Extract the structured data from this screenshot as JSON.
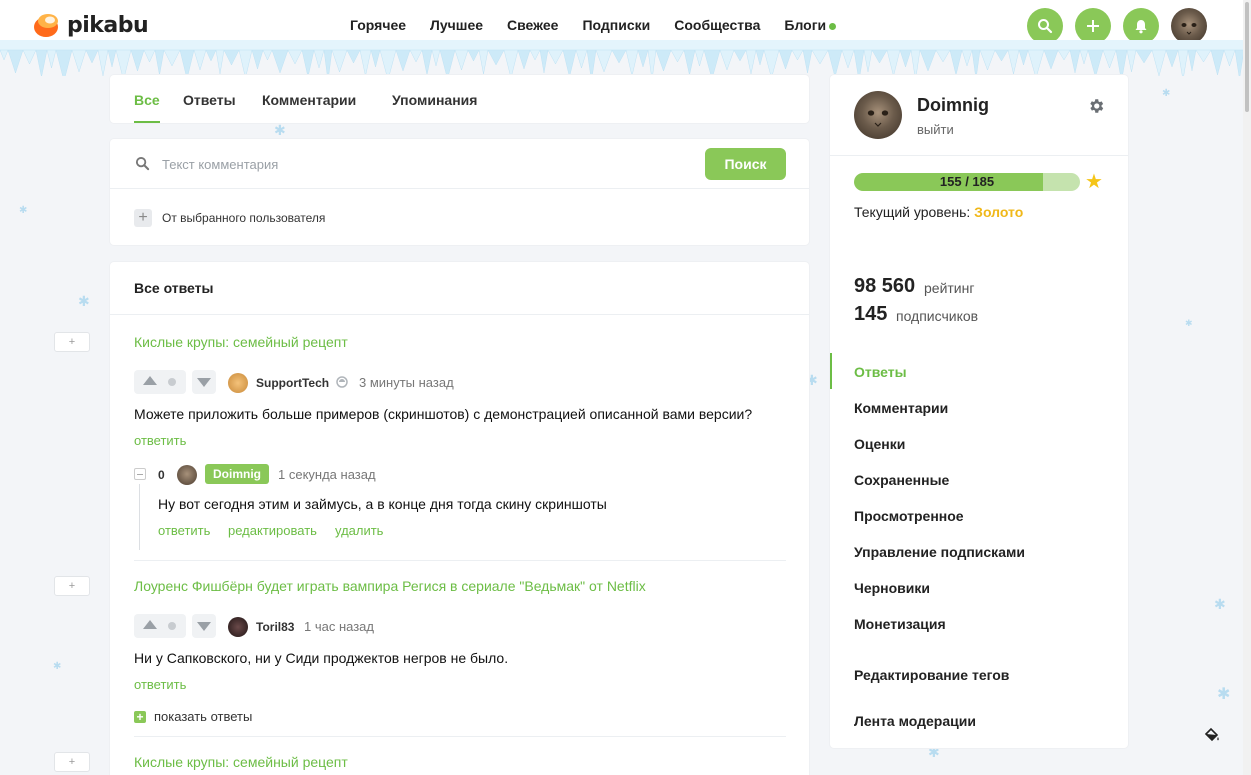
{
  "brand": {
    "name": "pikabu"
  },
  "nav": [
    {
      "label": "Горячее"
    },
    {
      "label": "Лучшее"
    },
    {
      "label": "Свежее"
    },
    {
      "label": "Подписки"
    },
    {
      "label": "Сообщества"
    },
    {
      "label": "Блоги"
    }
  ],
  "header_icons": [
    "search-icon",
    "plus-icon",
    "bell-icon",
    "avatar"
  ],
  "tabs": [
    {
      "label": "Все",
      "active": true
    },
    {
      "label": "Ответы"
    },
    {
      "label": "Комментарии"
    },
    {
      "label": "Упоминания"
    }
  ],
  "search": {
    "placeholder": "Текст комментария",
    "button": "Поиск",
    "filter_label": "От выбранного пользователя"
  },
  "answers": {
    "title": "Все ответы",
    "threads": [
      {
        "post_title": "Кислые крупы: семейный рецепт",
        "comment": {
          "author": "SupportTech",
          "time": "3 минуты назад",
          "text": "Можете приложить больше примеров (скриншотов) с демонстрацией описанной вами версии?",
          "reply_label": "ответить"
        },
        "my_reply": {
          "score": "0",
          "author": "Doimnig",
          "time": "1 секунда назад",
          "text": "Ну вот сегодня этим и займусь, а в конце дня тогда скину скриншоты",
          "actions": [
            "ответить",
            "редактировать",
            "удалить"
          ]
        }
      },
      {
        "post_title": "Лоуренс Фишбёрн будет играть вампира Регися в сериале \"Ведьмак\" от Netflix",
        "comment": {
          "author": "Toril83",
          "time": "1 час назад",
          "text": "Ни у Сапковского, ни у Сиди проджектов негров не было.",
          "reply_label": "ответить"
        },
        "show_replies": "показать ответы"
      },
      {
        "post_title": "Кислые крупы: семейный рецепт"
      }
    ]
  },
  "profile": {
    "name": "Doimnig",
    "logout": "выйти",
    "progress_text": "155 / 185",
    "progress_fraction": 0.838,
    "level_label": "Текущий уровень:",
    "level_value": "Золото",
    "rating_value": "98 560",
    "rating_label": "рейтинг",
    "subscribers_value": "145",
    "subscribers_label": "подписчиков",
    "menu": [
      {
        "label": "Ответы",
        "active": true
      },
      {
        "label": "Комментарии"
      },
      {
        "label": "Оценки"
      },
      {
        "label": "Сохраненные"
      },
      {
        "label": "Просмотренное"
      },
      {
        "label": "Управление подписками"
      },
      {
        "label": "Черновики"
      },
      {
        "label": "Монетизация"
      },
      {
        "label": "Редактирование тегов"
      },
      {
        "label": "Лента модерации"
      }
    ]
  },
  "colors": {
    "accent": "#6cbd45",
    "button": "#8ac858",
    "gold": "#f0b819",
    "background": "#f3f5f8"
  }
}
